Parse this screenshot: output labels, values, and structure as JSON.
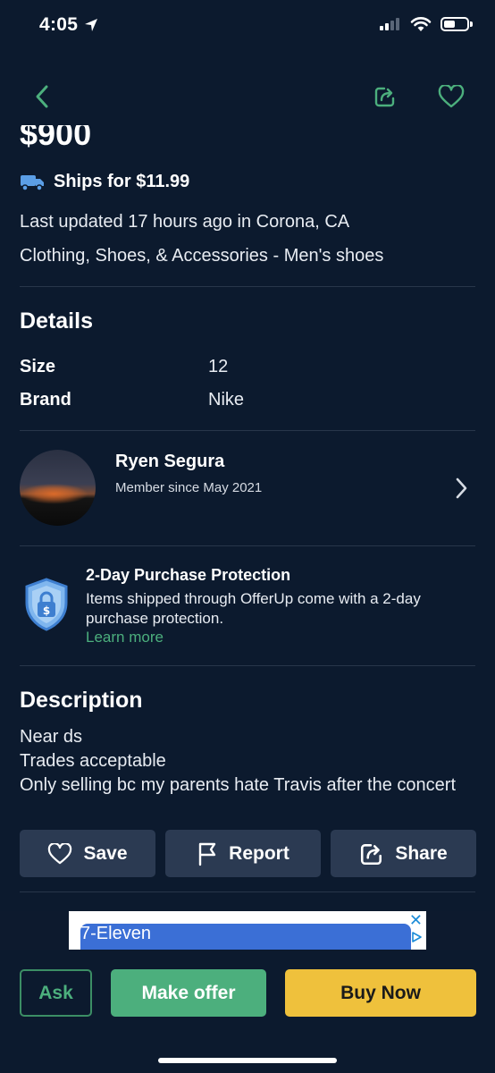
{
  "status_bar": {
    "time": "4:05",
    "icons": [
      "location-arrow-icon",
      "cellular-signal-icon",
      "wifi-icon",
      "battery-icon"
    ]
  },
  "nav": {
    "icons": [
      "back-chevron-icon",
      "share-icon",
      "heart-icon"
    ],
    "accent_color": "#4caf7d"
  },
  "listing": {
    "price": "$900",
    "shipping": "Ships for $11.99",
    "last_updated": "Last updated 17 hours ago in Corona, CA",
    "category": "Clothing, Shoes, & Accessories - Men's shoes"
  },
  "details": {
    "title": "Details",
    "rows": [
      {
        "label": "Size",
        "value": "12"
      },
      {
        "label": "Brand",
        "value": "Nike"
      }
    ]
  },
  "seller": {
    "name": "Ryen Segura",
    "member_since": "Member since May 2021"
  },
  "protection": {
    "title": "2-Day Purchase Protection",
    "body": "Items shipped through OfferUp come with a 2-day purchase protection.",
    "link": "Learn more"
  },
  "description": {
    "title": "Description",
    "lines": [
      "Near ds",
      "Trades acceptable",
      "Only selling bc my parents hate Travis after the concert"
    ]
  },
  "actions": {
    "save": "Save",
    "report": "Report",
    "share": "Share"
  },
  "ad": {
    "text": "7-Eleven",
    "close": "✕"
  },
  "bottom": {
    "ask": "Ask",
    "make_offer": "Make offer",
    "buy_now": "Buy Now"
  },
  "colors": {
    "background": "#0c1a2e",
    "green": "#4caf7d",
    "yellow": "#efc13c",
    "button_bg": "#2b3a52"
  }
}
